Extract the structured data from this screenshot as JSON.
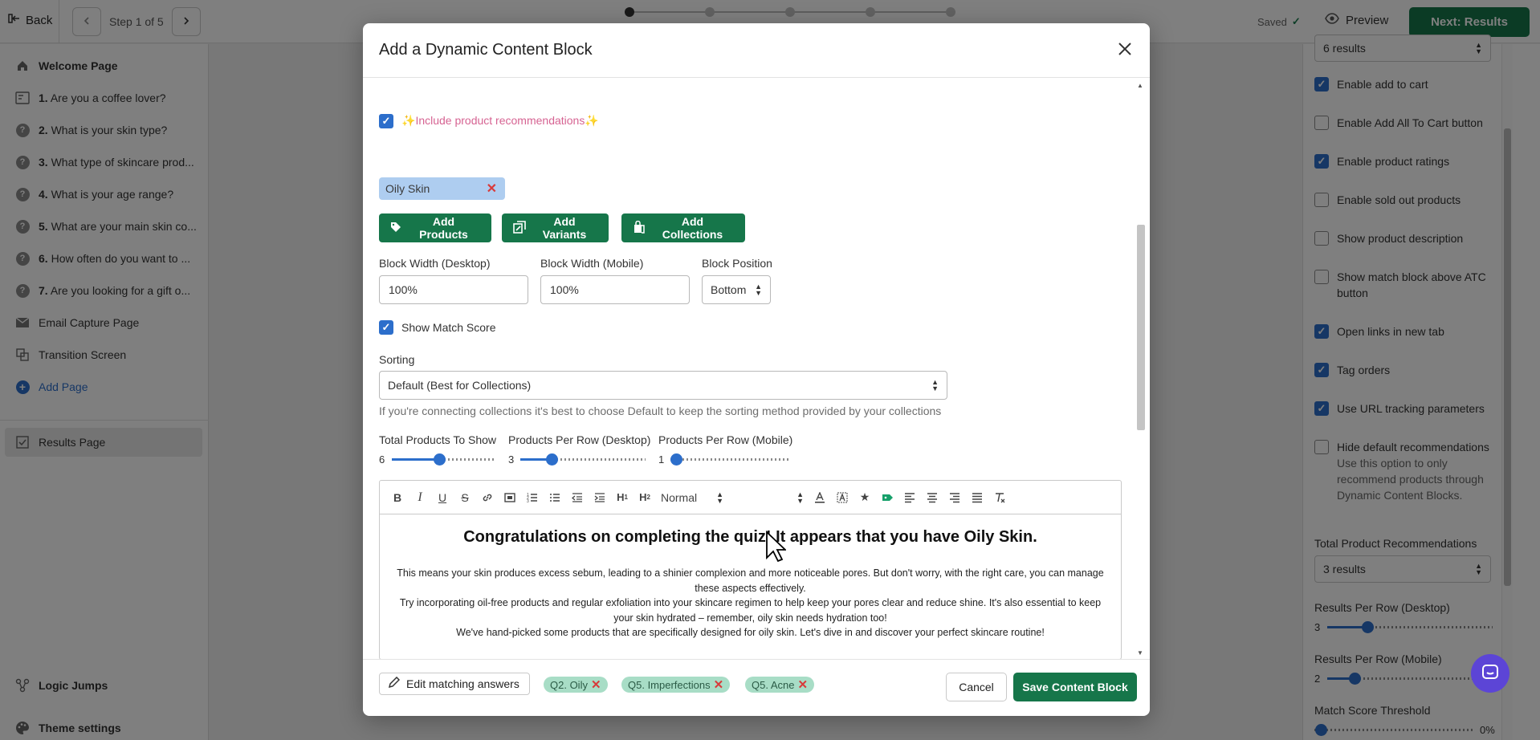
{
  "topbar": {
    "back": "Back",
    "step": "Step 1 of 5",
    "saved": "Saved",
    "preview": "Preview",
    "next": "Next: Results"
  },
  "sidebar": {
    "welcome": "Welcome Page",
    "questions": [
      {
        "num": "1.",
        "label": "Are you a coffee lover?"
      },
      {
        "num": "2.",
        "label": "What is your skin type?"
      },
      {
        "num": "3.",
        "label": "What type of skincare prod..."
      },
      {
        "num": "4.",
        "label": "What is your age range?"
      },
      {
        "num": "5.",
        "label": "What are your main skin co..."
      },
      {
        "num": "6.",
        "label": "How often do you want to ..."
      },
      {
        "num": "7.",
        "label": "Are you looking for a gift o..."
      }
    ],
    "email": "Email Capture Page",
    "transition": "Transition Screen",
    "add_page": "Add Page",
    "results": "Results Page",
    "logic": "Logic Jumps",
    "theme": "Theme settings"
  },
  "right_panel": {
    "top_select": "6 results",
    "options": [
      {
        "label": "Enable add to cart",
        "checked": true
      },
      {
        "label": "Enable Add All To Cart button",
        "checked": false
      },
      {
        "label": "Enable product ratings",
        "checked": true
      },
      {
        "label": "Enable sold out products",
        "checked": false
      },
      {
        "label": "Show product description",
        "checked": false
      },
      {
        "label": "Show match block above ATC button",
        "checked": false
      },
      {
        "label": "Open links in new tab",
        "checked": true
      },
      {
        "label": "Tag orders",
        "checked": true
      },
      {
        "label": "Use URL tracking parameters",
        "checked": true
      },
      {
        "label": "Hide default recommendations",
        "checked": false
      }
    ],
    "hide_hint": "Use this option to only recommend products through Dynamic Content Blocks.",
    "total_label": "Total Product Recommendations",
    "total_value": "3 results",
    "per_row_desktop_label": "Results Per Row (Desktop)",
    "per_row_desktop_value": "3",
    "per_row_mobile_label": "Results Per Row (Mobile)",
    "per_row_mobile_value": "2",
    "threshold_label": "Match Score Threshold",
    "threshold_value": "0%"
  },
  "modal": {
    "title": "Add a Dynamic Content Block",
    "include_label": "Include product recommendations",
    "include_checked": true,
    "tag": "Oily Skin",
    "btn_products": "Add Products",
    "btn_variants": "Add Variants",
    "btn_collections": "Add Collections",
    "width_desktop_label": "Block Width (Desktop)",
    "width_desktop_value": "100%",
    "width_mobile_label": "Block Width (Mobile)",
    "width_mobile_value": "100%",
    "position_label": "Block Position",
    "position_value": "Bottom",
    "match_score_label": "Show Match Score",
    "match_score_checked": true,
    "sorting_label": "Sorting",
    "sorting_value": "Default (Best for Collections)",
    "sorting_hint": "If you're connecting collections it's best to choose Default to keep the sorting method provided by your collections",
    "total_label": "Total Products To Show",
    "total_value": "6",
    "per_row_desktop_label": "Products Per Row (Desktop)",
    "per_row_desktop_value": "3",
    "per_row_mobile_label": "Products Per Row (Mobile)",
    "per_row_mobile_value": "1",
    "editor": {
      "format": "Normal",
      "heading": "Congratulations on completing the quiz! It appears that you have Oily Skin.",
      "p1": "This means your skin produces excess sebum, leading to a shinier complexion and more noticeable pores. But don't worry, with the right care, you can manage these aspects effectively.",
      "p2": "Try incorporating oil-free products and regular exfoliation into your skincare regimen to help keep your pores clear and reduce shine. It's also essential to keep your skin hydrated – remember, oily skin needs hydration too!",
      "p3": "We've hand-picked some products that are specifically designed for oily skin. Let's dive in and discover your perfect skincare routine!"
    },
    "edit_matching": "Edit matching answers",
    "answers": [
      "Q2. Oily",
      "Q5. Imperfections",
      "Q5. Acne"
    ],
    "cancel": "Cancel",
    "save": "Save Content Block"
  },
  "colors": {
    "primary_green": "#16764a",
    "accent_blue": "#2c6ecb",
    "chat_purple": "#5c45d6"
  }
}
